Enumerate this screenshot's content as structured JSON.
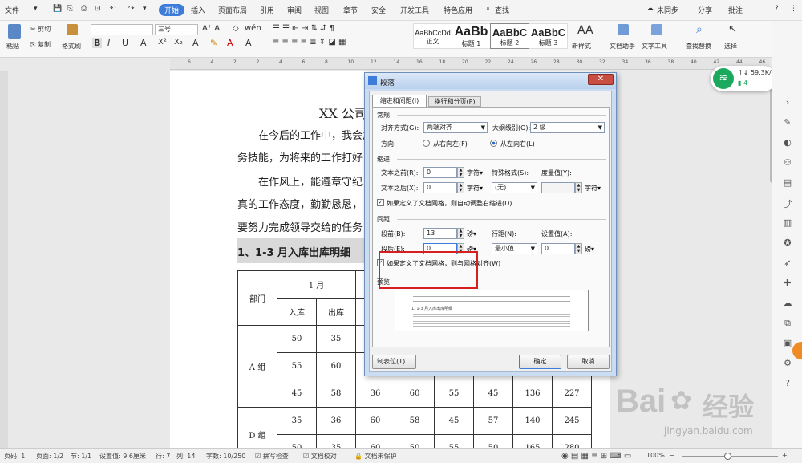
{
  "menu": {
    "items": [
      "文件",
      "开始",
      "插入",
      "页面布局",
      "引用",
      "审阅",
      "视图",
      "章节",
      "安全",
      "开发工具",
      "特色应用"
    ],
    "search": "查找",
    "right": [
      "未同步",
      "分享",
      "批注"
    ]
  },
  "ribbon": {
    "paste": "粘贴",
    "cut": "剪切",
    "copy": "复制",
    "format_painter": "格式刷",
    "font_size": "三号",
    "styles": [
      {
        "sample": "AaBbCcDd",
        "label": "正文"
      },
      {
        "sample": "AaBb",
        "label": "标题 1"
      },
      {
        "sample": "AaBbC",
        "label": "标题 2"
      },
      {
        "sample": "AaBbC",
        "label": "标题 3"
      }
    ],
    "new_style": "新样式",
    "assistant": "文档助手",
    "text_tool": "文字工具",
    "find_replace": "查找替换",
    "select": "选择"
  },
  "ruler_ticks": [
    "6",
    "4",
    "2",
    "2",
    "4",
    "6",
    "8",
    "10",
    "12",
    "14",
    "16",
    "18",
    "20",
    "22",
    "24",
    "26",
    "28",
    "30",
    "32",
    "34",
    "36",
    "38",
    "40",
    "42",
    "44",
    "46"
  ],
  "document": {
    "title": "XX 公司",
    "lines": [
      "在今后的工作中，我会加",
      "务技能，为将来的工作打好",
      "在作风上，能遵章守纪",
      "真的工作态度，勤勤恳恳，",
      "要努力完成领导交给的任务"
    ],
    "heading": "1、1-3 月入库出库明细",
    "table": {
      "dept_header": "部门",
      "month1": "1 月",
      "in": "入库",
      "out": "出库",
      "groups": [
        "A 组",
        "D 组"
      ],
      "rows": [
        [
          "50",
          "35",
          "",
          "",
          "",
          "",
          "",
          ""
        ],
        [
          "55",
          "60",
          "",
          "",
          "",
          "",
          "",
          ""
        ],
        [
          "45",
          "58",
          "36",
          "60",
          "55",
          "45",
          "136",
          "227"
        ],
        [
          "35",
          "36",
          "60",
          "58",
          "45",
          "57",
          "140",
          "245"
        ],
        [
          "50",
          "35",
          "60",
          "50",
          "55",
          "50",
          "165",
          "280"
        ]
      ]
    }
  },
  "dialog": {
    "title": "段落",
    "tabs": [
      "缩进和间距(I)",
      "换行和分页(P)"
    ],
    "general": "常规",
    "align_label": "对齐方式(G):",
    "align_value": "两端对齐",
    "outline_label": "大纲级别(O):",
    "outline_value": "2 级",
    "direction_label": "方向:",
    "rtl": "从右向左(F)",
    "ltr": "从左向右(L)",
    "indent": "缩进",
    "before_text": "文本之前(R):",
    "before_text_value": "0",
    "after_text": "文本之后(X):",
    "after_text_value": "0",
    "unit_char": "字符▾",
    "special_label": "特殊格式(S):",
    "special_value": "(无)",
    "measure_label": "度量值(Y):",
    "grid_indent": "如果定义了文档网格，则自动调整右缩进(D)",
    "spacing": "间距",
    "space_before": "段前(B):",
    "space_before_value": "13",
    "space_after": "段后(E):",
    "space_after_value": "0",
    "unit_pt": "磅▾",
    "line_spacing_label": "行距(N):",
    "line_spacing_value": "最小值",
    "setting_label": "设置值(A):",
    "setting_value": "0",
    "grid_align": "如果定义了文档网格，则与网格对齐(W)",
    "preview": "预览",
    "preview_heading": "1. 1-3 月入库出库明细",
    "tab_button": "制表位(T)...",
    "ok": "确定",
    "cancel": "取消"
  },
  "wifi": {
    "speed": "59.3K/s",
    "count": "4"
  },
  "status": [
    "页码: 1",
    "页面: 1/2",
    "节: 1/1",
    "设置值: 9.6厘米",
    "行: 7",
    "列: 14",
    "字数: 10/250",
    "拼写检查",
    "文档校对",
    "文档未保护",
    "100%"
  ],
  "watermark": {
    "brand": "Bai",
    "cn": "经验",
    "url": "jingyan.baidu.com"
  },
  "colors": {
    "accent": "#3d7cd9",
    "highlight": "#d62020",
    "wifi": "#1aa95d"
  }
}
